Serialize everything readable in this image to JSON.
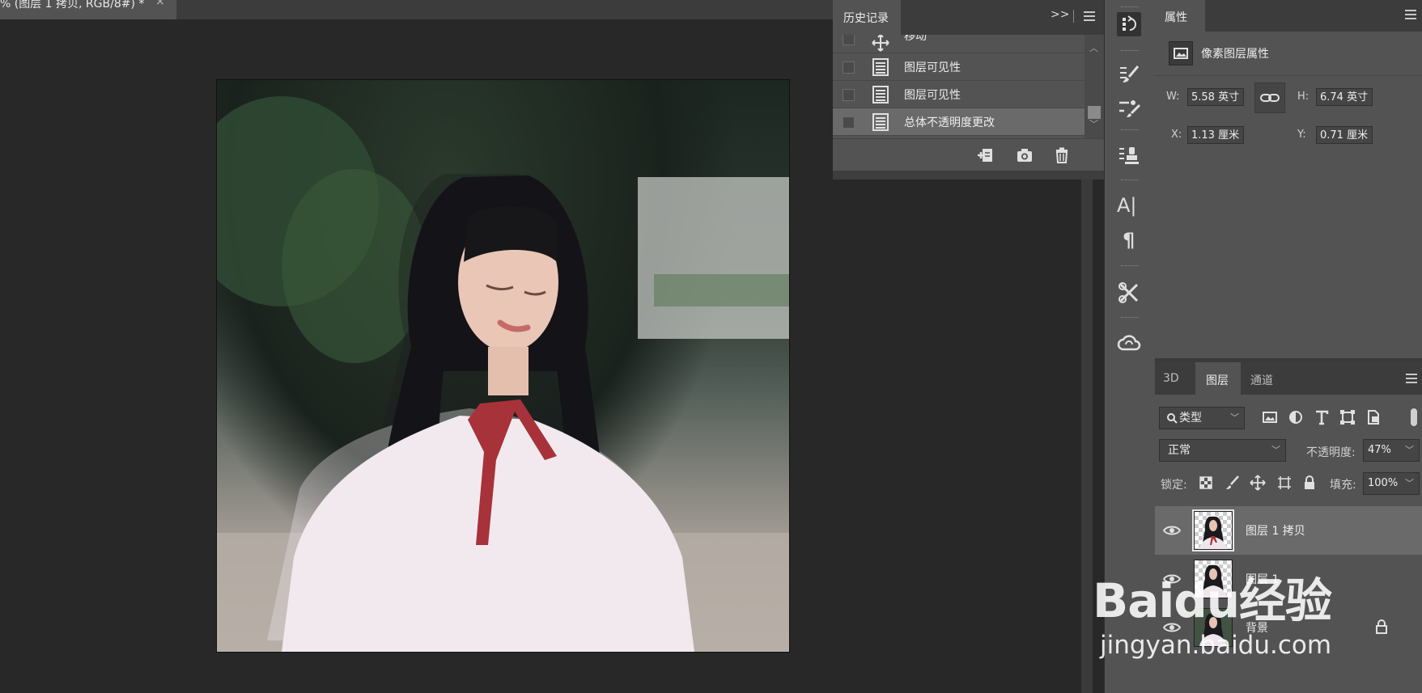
{
  "document": {
    "tab_title": "% (图层 1 拷贝, RGB/8#) *",
    "close": "×"
  },
  "history": {
    "tab_label": "历史记录",
    "expand_glyph": ">>",
    "items": [
      {
        "label": "移动",
        "icon": "move-icon"
      },
      {
        "label": "图层可见性",
        "icon": "document-icon"
      },
      {
        "label": "图层可见性",
        "icon": "document-icon"
      },
      {
        "label": "总体不透明度更改",
        "icon": "document-icon",
        "selected": true
      }
    ],
    "footer_icons": [
      "new-document-from-state-icon",
      "snapshot-camera-icon",
      "trash-icon"
    ]
  },
  "tools": [
    {
      "name": "history-tool-icon",
      "active": true
    },
    {
      "name": "brush-settings-icon"
    },
    {
      "name": "brush-presets-icon"
    },
    {
      "name": "clone-source-icon"
    },
    {
      "name": "character-icon",
      "glyph": "A|"
    },
    {
      "name": "paragraph-icon",
      "glyph": "¶"
    },
    {
      "name": "tool-presets-icon"
    },
    {
      "name": "creative-cloud-icon"
    }
  ],
  "properties": {
    "tab_label": "属性",
    "subtitle": "像素图层属性",
    "w_label": "W:",
    "w_value": "5.58 英寸",
    "h_label": "H:",
    "h_value": "6.74 英寸",
    "x_label": "X:",
    "x_value": "1.13 厘米",
    "y_label": "Y:",
    "y_value": "0.71 厘米"
  },
  "layers": {
    "tabs": [
      {
        "label": "3D"
      },
      {
        "label": "图层",
        "selected": true
      },
      {
        "label": "通道"
      }
    ],
    "filter_label": "类型",
    "blend_mode": "正常",
    "opacity_label": "不透明度:",
    "opacity_value": "47%",
    "lock_label": "锁定:",
    "fill_label": "填充:",
    "fill_value": "100%",
    "items": [
      {
        "name": "图层 1 拷贝",
        "visible": true,
        "selected": true
      },
      {
        "name": "图层 1",
        "visible": true
      },
      {
        "name": "背景",
        "visible": true,
        "locked": true
      }
    ]
  },
  "watermark": {
    "brand": "Baidu经验",
    "url": "jingyan.baidu.com"
  },
  "colors": {
    "workspace": "#282828",
    "panel": "#535353",
    "panel_header": "#3c3c3c",
    "selected_row": "#6a6a6a"
  }
}
